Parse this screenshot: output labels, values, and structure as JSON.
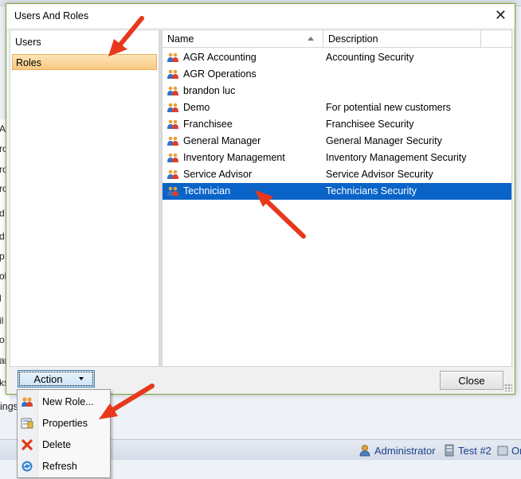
{
  "dialog": {
    "title": "Users And Roles",
    "nav": [
      {
        "label": "Users",
        "selected": false
      },
      {
        "label": "Roles",
        "selected": true
      }
    ],
    "grid": {
      "columns": [
        "Name",
        "Description"
      ],
      "rows": [
        {
          "name": "AGR Accounting",
          "description": "Accounting Security",
          "selected": false
        },
        {
          "name": "AGR Operations",
          "description": "",
          "selected": false
        },
        {
          "name": "brandon luc",
          "description": "",
          "selected": false
        },
        {
          "name": "Demo",
          "description": "For potential new customers",
          "selected": false
        },
        {
          "name": "Franchisee",
          "description": "Franchisee Security",
          "selected": false
        },
        {
          "name": "General Manager",
          "description": "General Manager Security",
          "selected": false
        },
        {
          "name": "Inventory Management",
          "description": "Inventory Management Security",
          "selected": false
        },
        {
          "name": "Service Advisor",
          "description": "Service Advisor Security",
          "selected": false
        },
        {
          "name": "Technician",
          "description": "Technicians Security",
          "selected": true
        }
      ]
    },
    "action_label": "Action",
    "close_label": "Close"
  },
  "context_menu": {
    "items": [
      {
        "label": "New Role...",
        "icon": "new-role-icon"
      },
      {
        "label": "Properties",
        "icon": "properties-icon"
      },
      {
        "label": "Delete",
        "icon": "delete-icon"
      },
      {
        "label": "Refresh",
        "icon": "refresh-icon"
      }
    ]
  },
  "background": {
    "left_fragments": [
      "A",
      "ro",
      "ro",
      "ro",
      "d",
      "d",
      "p",
      "ol",
      "l",
      "il",
      "o",
      "ar",
      "ks"
    ],
    "partial_text": "ings",
    "status": {
      "user": "Administrator",
      "server": "Test #2",
      "extra": "Or"
    }
  },
  "colors": {
    "selection_blue": "#0a64c8",
    "nav_selection": "#f8c983",
    "arrow_red": "#e8381c",
    "dialog_border": "#7aa63c"
  }
}
